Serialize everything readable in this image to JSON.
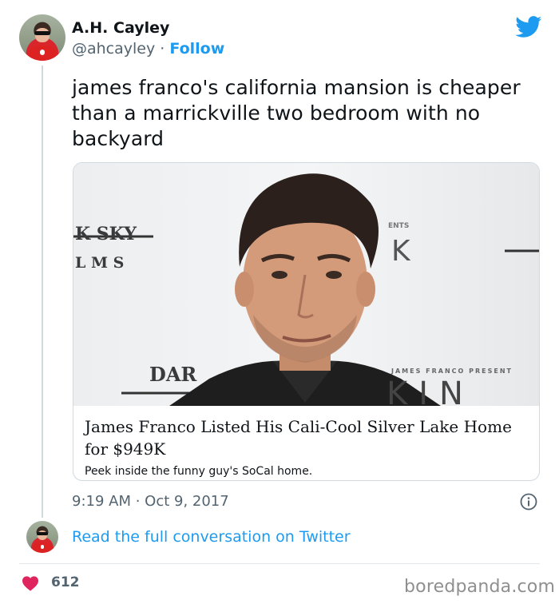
{
  "author": {
    "name": "A.H. Cayley",
    "handle": "@ahcayley",
    "separator": " · ",
    "follow_label": "Follow"
  },
  "tweet": {
    "text": "james franco's california mansion is cheaper than a marrickville two bedroom with no backyard"
  },
  "card": {
    "title": "James Franco Listed His Cali-Cool Silver Lake Home for $949K",
    "description": "Peek inside the funny guy's SoCal home.",
    "backdrop_texts": {
      "sky": "K SKY",
      "lms": "L M S",
      "dar": "DAR",
      "k": "K",
      "kin": "KIN",
      "sub": "JAMES FRANCO PRESENT",
      "top": "ENTS"
    }
  },
  "timestamp": "9:19 AM · Oct 9, 2017",
  "read_more_label": "Read the full conversation on Twitter",
  "likes": "612",
  "watermark": "boredpanda.com",
  "icons": {
    "brand": "twitter-bird-icon",
    "info": "info-icon",
    "like": "heart-icon"
  },
  "colors": {
    "twitter_blue": "#1d9bf0",
    "heart": "#e0245e",
    "muted": "#536471"
  }
}
